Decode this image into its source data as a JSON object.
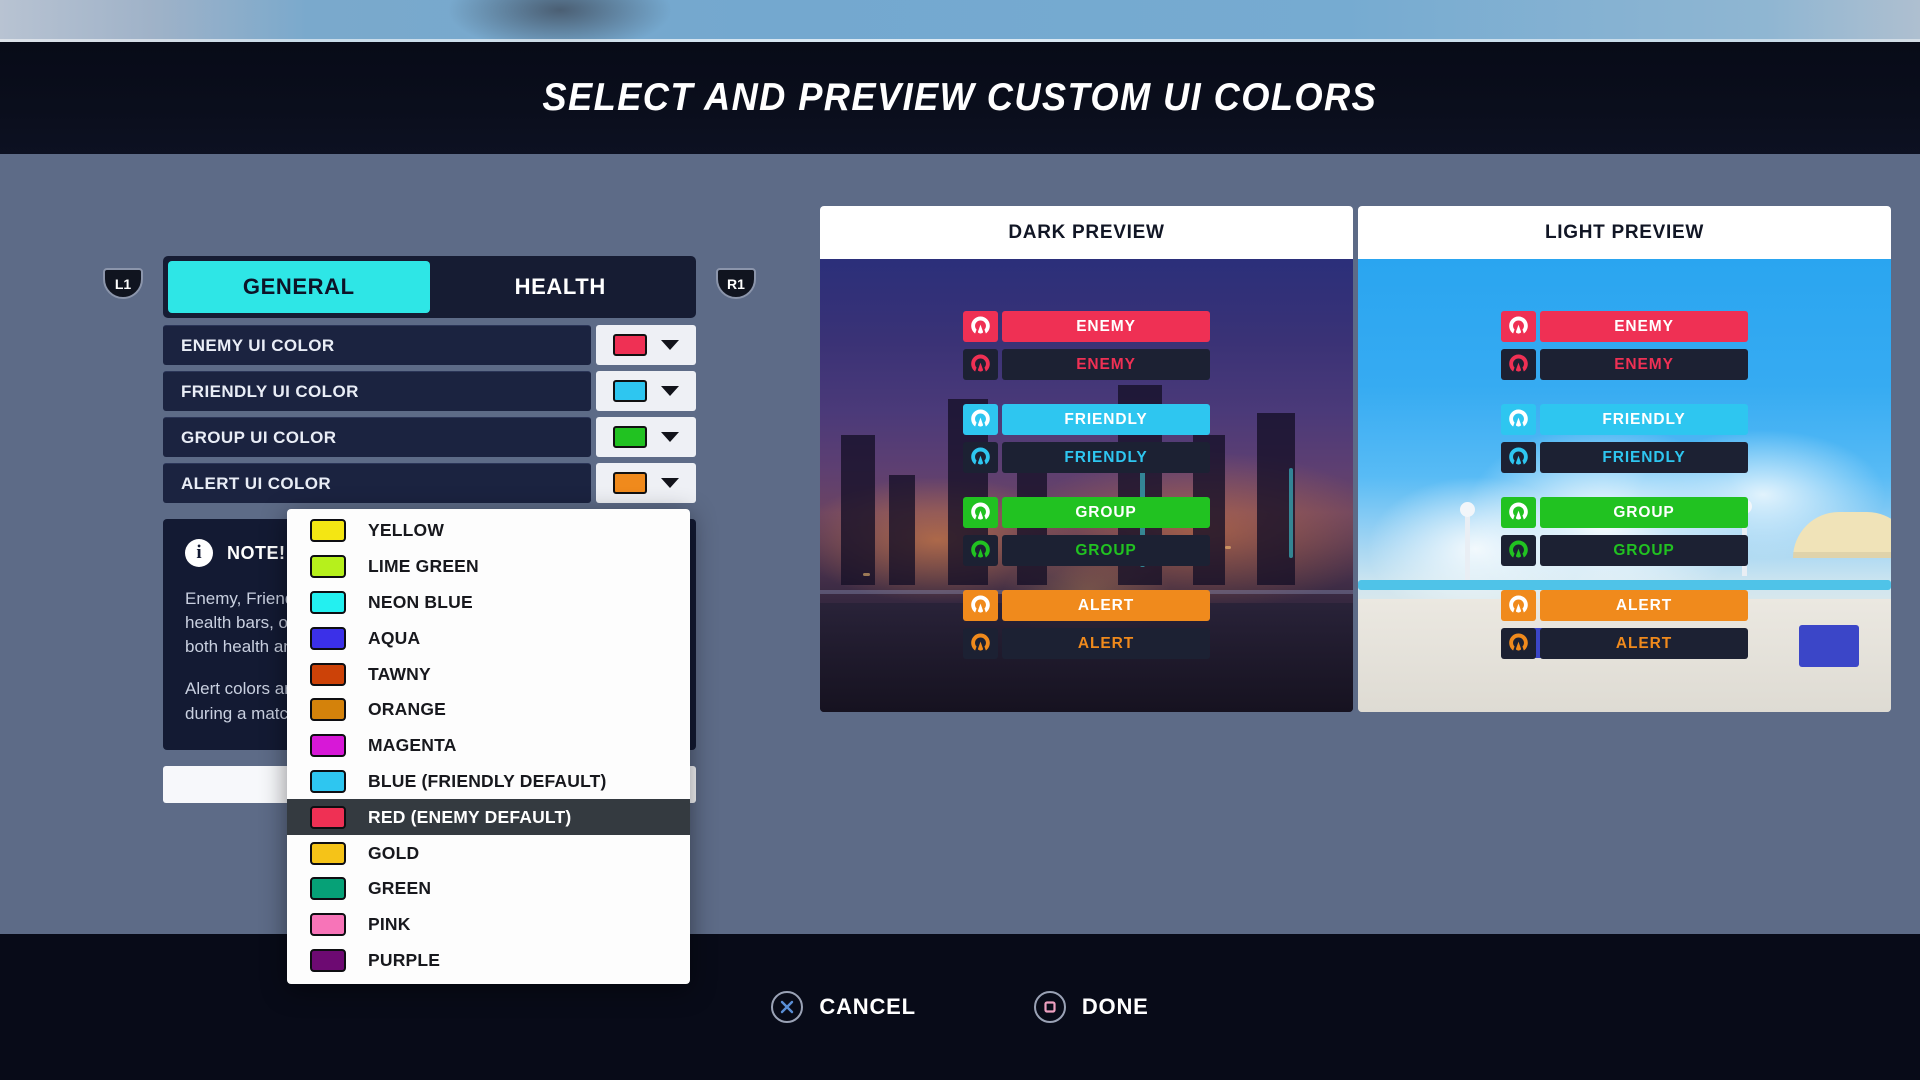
{
  "header": {
    "title": "SELECT AND PREVIEW CUSTOM UI COLORS"
  },
  "bumpers": {
    "left": "L1",
    "right": "R1"
  },
  "tabs": [
    {
      "label": "GENERAL",
      "active": true
    },
    {
      "label": "HEALTH",
      "active": false
    }
  ],
  "settings": {
    "rows": [
      {
        "label": "ENEMY UI COLOR",
        "swatch": "#ef3054"
      },
      {
        "label": "FRIENDLY UI COLOR",
        "swatch": "#2ec6f0"
      },
      {
        "label": "GROUP UI COLOR",
        "swatch": "#21c221"
      },
      {
        "label": "ALERT UI COLOR",
        "swatch": "#f08a1c"
      }
    ]
  },
  "note": {
    "icon": "info-icon",
    "title": "NOTE!",
    "paragraph_1": "Enemy, Friendly and Group colors affect UI elements such as health bars, outlines and information panels. Changes apply to both health and name plate displays.",
    "paragraph_2": "Alert colors are used for warnings and critical information shown during a match."
  },
  "dropdown": {
    "selected": "RED (ENEMY DEFAULT)",
    "options": [
      {
        "label": "YELLOW",
        "color": "#f4e613"
      },
      {
        "label": "LIME GREEN",
        "color": "#b6f01c"
      },
      {
        "label": "NEON BLUE",
        "color": "#23f0f0"
      },
      {
        "label": "AQUA",
        "color": "#3b30e8"
      },
      {
        "label": "TAWNY",
        "color": "#cc4208"
      },
      {
        "label": "ORANGE",
        "color": "#d4820b"
      },
      {
        "label": "MAGENTA",
        "color": "#d718d7"
      },
      {
        "label": "BLUE (FRIENDLY DEFAULT)",
        "color": "#2ec6f0"
      },
      {
        "label": "RED (ENEMY DEFAULT)",
        "color": "#ef3054"
      },
      {
        "label": "GOLD",
        "color": "#f5c318"
      },
      {
        "label": "GREEN",
        "color": "#06a177"
      },
      {
        "label": "PINK",
        "color": "#f774b8"
      },
      {
        "label": "PURPLE",
        "color": "#6d0a72"
      }
    ]
  },
  "previews": [
    {
      "title": "DARK PREVIEW",
      "theme": "dark",
      "groups": [
        {
          "filled": {
            "label": "ENEMY",
            "color": "#ef3054"
          },
          "empty": {
            "label": "ENEMY",
            "color": "#ef3054"
          }
        },
        {
          "filled": {
            "label": "FRIENDLY",
            "color": "#2ec6f0"
          },
          "empty": {
            "label": "FRIENDLY",
            "color": "#2ec6f0"
          }
        },
        {
          "filled": {
            "label": "GROUP",
            "color": "#21c221"
          },
          "empty": {
            "label": "GROUP",
            "color": "#21c221"
          }
        },
        {
          "filled": {
            "label": "ALERT",
            "color": "#f08a1c"
          },
          "empty": {
            "label": "ALERT",
            "color": "#f08a1c"
          }
        }
      ]
    },
    {
      "title": "LIGHT PREVIEW",
      "theme": "light",
      "groups": [
        {
          "filled": {
            "label": "ENEMY",
            "color": "#ef3054"
          },
          "empty": {
            "label": "ENEMY",
            "color": "#ef3054"
          }
        },
        {
          "filled": {
            "label": "FRIENDLY",
            "color": "#2ec6f0"
          },
          "empty": {
            "label": "FRIENDLY",
            "color": "#2ec6f0"
          }
        },
        {
          "filled": {
            "label": "GROUP",
            "color": "#21c221"
          },
          "empty": {
            "label": "GROUP",
            "color": "#21c221"
          }
        },
        {
          "filled": {
            "label": "ALERT",
            "color": "#f08a1c"
          },
          "empty": {
            "label": "ALERT",
            "color": "#f08a1c"
          }
        }
      ]
    }
  ],
  "footer": {
    "cancel": {
      "label": "CANCEL",
      "glyph": "cross-button-icon",
      "color": "#5a8fd6"
    },
    "done": {
      "label": "DONE",
      "glyph": "square-button-icon",
      "color": "#eda0c0"
    }
  }
}
